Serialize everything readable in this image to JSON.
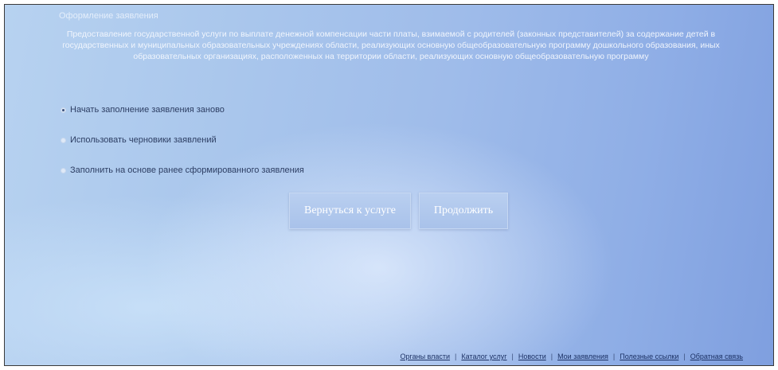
{
  "form": {
    "section_title": "Оформление заявления",
    "description": "Предоставление государственной услуги по выплате денежной компенсации части платы, взимаемой с родителей (законных представителей) за содержание детей в государственных и муниципальных образовательных учреждениях области, реализующих основную общеобразовательную программу дошкольного образования, иных образовательных организациях, расположенных на территории области, реализующих основную общеобразовательную программу"
  },
  "options": [
    {
      "label": "Начать заполнение заявления заново",
      "checked": true
    },
    {
      "label": "Использовать черновики заявлений",
      "checked": false
    },
    {
      "label": "Заполнить на основе ранее сформированного заявления",
      "checked": false
    }
  ],
  "buttons": {
    "back_label": "Вернуться к услуге",
    "continue_label": "Продолжить"
  },
  "footer": {
    "links": [
      "Органы власти",
      "Каталог услуг",
      "Новости",
      "Мои заявления",
      "Полезные ссылки",
      "Обратная связь"
    ]
  }
}
